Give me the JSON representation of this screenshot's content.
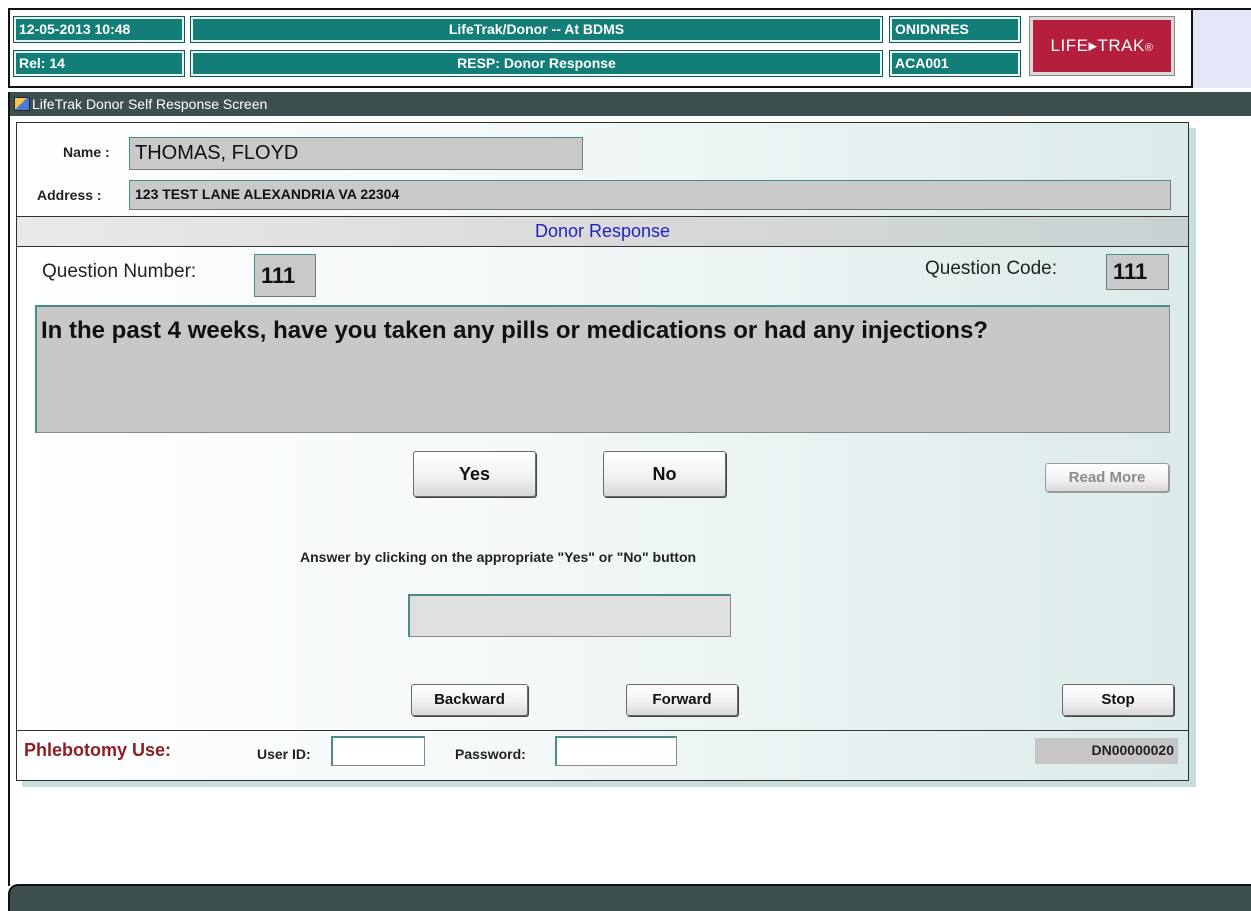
{
  "header": {
    "datetime": "12-05-2013  10:48",
    "release": "Rel: 14",
    "app_title": "LifeTrak/Donor -- At BDMS",
    "screen_title": "RESP: Donor Response",
    "program_code": "ONIDNRES",
    "user_code": "ACA001",
    "logo_text": "LIFE▸TRAK",
    "logo_mark": "®"
  },
  "window": {
    "title": "LifeTrak Donor Self Response Screen",
    "icon": "app-icon"
  },
  "donor": {
    "name_label": "Name :",
    "name_value": "THOMAS, FLOYD",
    "address_label": "Address :",
    "address_value": "123 TEST LANE  ALEXANDRIA VA 22304"
  },
  "section": {
    "title": "Donor Response"
  },
  "question": {
    "number_label": "Question Number:",
    "number_value": "111",
    "code_label": "Question Code:",
    "code_value": "111",
    "text": "In the past 4 weeks, have you taken any pills or medications or had any injections?"
  },
  "buttons": {
    "yes": "Yes",
    "no": "No",
    "read_more": "Read More",
    "backward": "Backward",
    "forward": "Forward",
    "stop": "Stop"
  },
  "instruction": "Answer by clicking on the appropriate \"Yes\"  or  \"No\" button",
  "answer_value": "",
  "footer": {
    "phlebotomy_label": "Phlebotomy Use:",
    "user_id_label": "User ID:",
    "user_id_value": "",
    "password_label": "Password:",
    "password_value": "",
    "donor_number": "DN00000020"
  },
  "colors": {
    "header_teal": "#137e78",
    "logo_red": "#b51f3d",
    "section_title_blue": "#1f24c8",
    "phlebotomy_red": "#8e1f24",
    "titlebar_dark": "#3e4f4f"
  }
}
